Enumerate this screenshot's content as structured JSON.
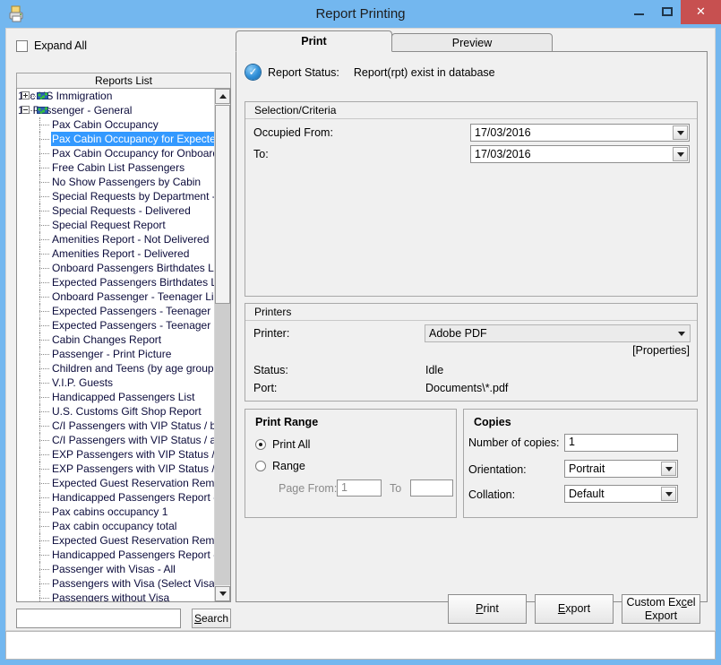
{
  "window": {
    "title": "Report Printing",
    "app_icon": "printer-icon",
    "minimize_label": "Minimize",
    "maximize_label": "Maximize",
    "close_label": "Close",
    "accent_color": "#73b7ef",
    "close_color": "#c75050"
  },
  "left_panel": {
    "expand_all_label": "Expand All",
    "expand_all_checked": false,
    "reports_list_header": "Reports List",
    "search": {
      "value": "",
      "placeholder": "",
      "button_label": "Search",
      "mnemonic": "S"
    },
    "tree": {
      "selected": "Pax Cabin Occupancy for Expected",
      "groups": [
        {
          "label": "10c US Immigration",
          "expanded": false,
          "expander": "plus",
          "items": []
        },
        {
          "label": "1a  Passenger - General",
          "expanded": true,
          "expander": "minus",
          "items": [
            "Pax Cabin Occupancy",
            "Pax Cabin Occupancy for Expected",
            "Pax Cabin Occupancy for Onboard",
            "Free Cabin List Passengers",
            "No Show Passengers by Cabin",
            "Special Requests by Department - ...",
            "Special Requests - Delivered",
            "Special Request Report",
            "Amenities Report - Not Delivered",
            "Amenities Report - Delivered",
            "Onboard Passengers Birthdates List",
            "Expected Passengers Birthdates List",
            "Onboard Passenger - Teenager List",
            "Expected Passengers - Teenager List",
            "Expected Passengers - Teenager ...",
            "Cabin Changes Report",
            "Passenger - Print Picture",
            "Children and Teens (by age groups)",
            "V.I.P. Guests",
            "Handicapped Passengers List",
            "U.S. Customs Gift Shop Report",
            "C/I Passengers with VIP Status / b...",
            "C/I Passengers with VIP Status / all",
            "EXP Passengers with VIP Status / ...",
            "EXP Passengers with VIP Status / all",
            "Expected Guest Reservation Rem...",
            "Handicapped Passengers Report - ...",
            "Pax cabins occupancy  1",
            "Pax cabin occupancy total",
            "Expected Guest Reservation Rem...",
            "Handicapped Passengers Report - ...",
            "Passenger with Visas - All",
            "Passengers with Visa  (Select Visa ...",
            "Passengers without Visa"
          ]
        }
      ]
    }
  },
  "tabs": [
    {
      "label": "Print",
      "active": true
    },
    {
      "label": "Preview",
      "active": false
    }
  ],
  "report_status": {
    "icon": "check-circle-icon",
    "label": "Report Status:",
    "value": "Report(rpt) exist in database"
  },
  "selection_criteria": {
    "title": "Selection/Criteria",
    "fields": [
      {
        "label": "Occupied From:",
        "value": "17/03/2016"
      },
      {
        "label": "To:",
        "value": "17/03/2016"
      }
    ]
  },
  "printers": {
    "title": "Printers",
    "printer_label": "Printer:",
    "printer_value": "Adobe PDF",
    "properties_link": "[Properties]",
    "status_label": "Status:",
    "status_value": "Idle",
    "port_label": "Port:",
    "port_value": "Documents\\*.pdf"
  },
  "print_range": {
    "title": "Print Range",
    "options": [
      {
        "label": "Print All",
        "selected": true
      },
      {
        "label": "Range",
        "selected": false
      }
    ],
    "page_from_label": "Page From:",
    "page_from_value": "1",
    "to_label": "To",
    "to_value": ""
  },
  "copies": {
    "title": "Copies",
    "number_label": "Number of copies:",
    "number_value": "1",
    "orientation_label": "Orientation:",
    "orientation_value": "Portrait",
    "collation_label": "Collation:",
    "collation_value": "Default"
  },
  "actions": [
    {
      "name": "print",
      "pre": "",
      "mn": "P",
      "post": "rint",
      "line2": ""
    },
    {
      "name": "export",
      "pre": "",
      "mn": "E",
      "post": "xport",
      "line2": ""
    },
    {
      "name": "custom-excel-export",
      "pre": "Custom Ex",
      "mn": "c",
      "post": "el",
      "line2": "Export"
    }
  ]
}
